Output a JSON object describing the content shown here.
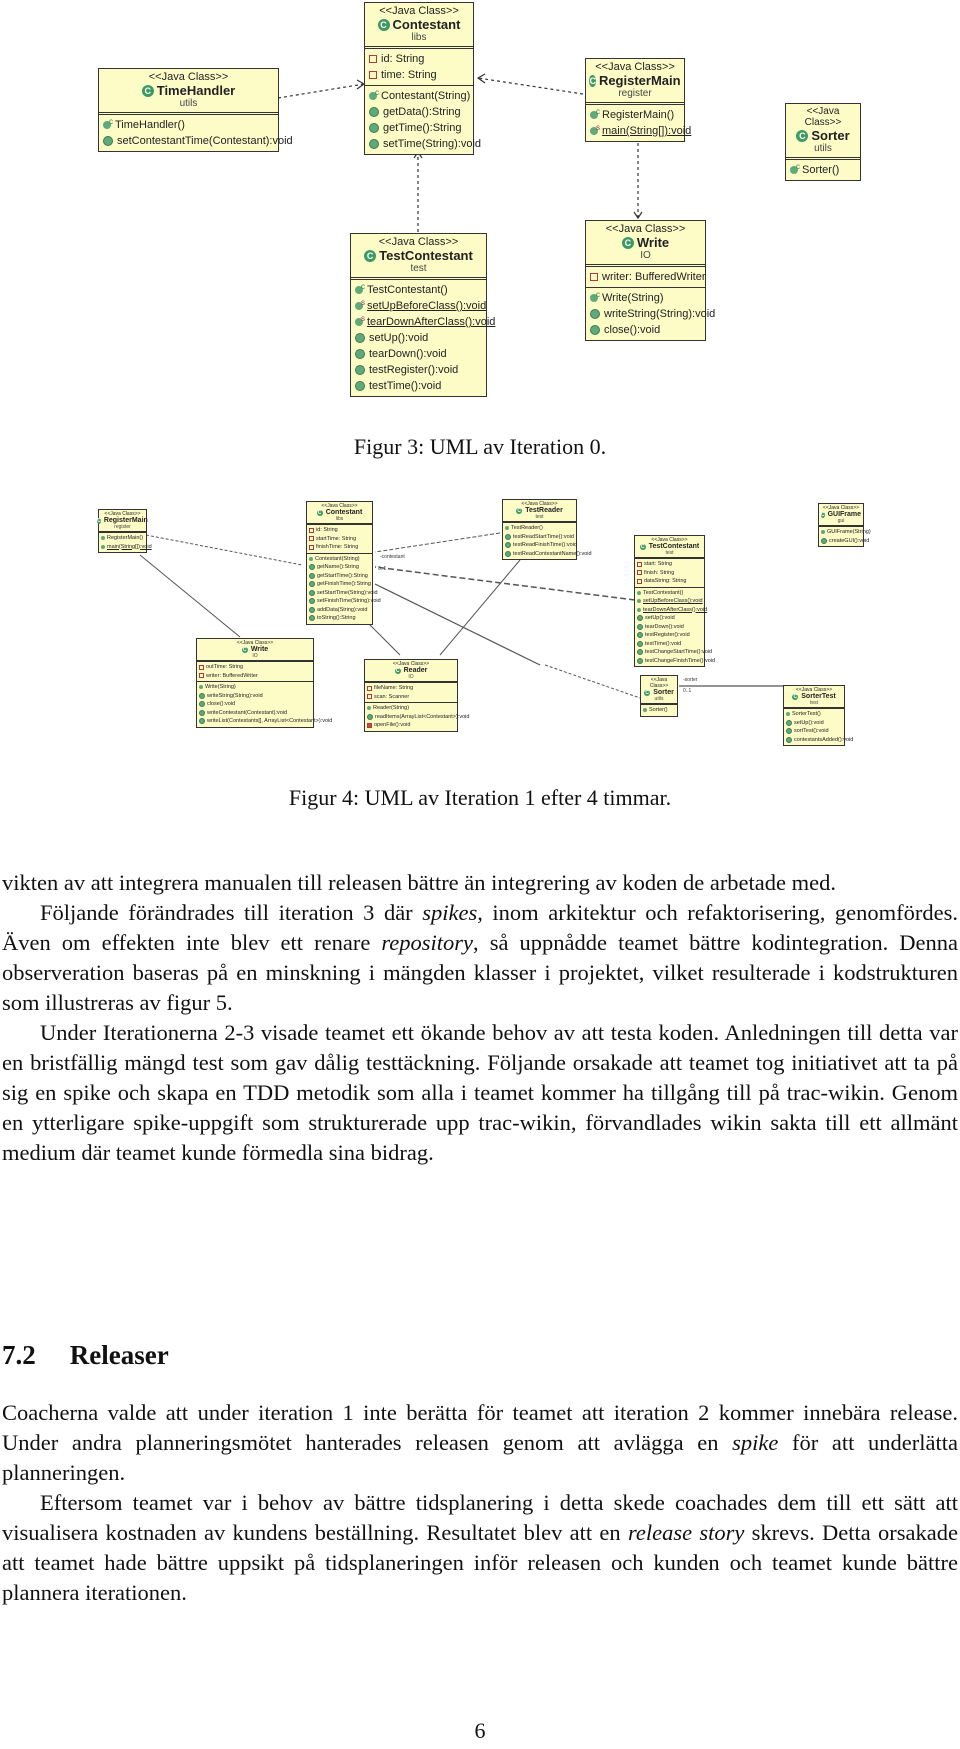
{
  "figure3": {
    "caption": "Figur 3: UML av Iteration 0.",
    "stereotype": "<<Java Class>>",
    "classes": {
      "timehandler": {
        "name": "TimeHandler",
        "package": "utils",
        "attributes": [],
        "methods": [
          "TimeHandler()",
          "setContestantTime(Contestant):void"
        ]
      },
      "contestant": {
        "name": "Contestant",
        "package": "libs",
        "attributes": [
          "id: String",
          "time: String"
        ],
        "methods": [
          "Contestant(String)",
          "getData():String",
          "getTime():String",
          "setTime(String):void"
        ]
      },
      "registermain": {
        "name": "RegisterMain",
        "package": "register",
        "attributes": [],
        "methods": [
          "RegisterMain()",
          "main(String[]):void"
        ]
      },
      "sorter": {
        "name": "Sorter",
        "package": "utils",
        "attributes": [],
        "methods": [
          "Sorter()"
        ]
      },
      "testcontestant": {
        "name": "TestContestant",
        "package": "test",
        "attributes": [],
        "methods": [
          "TestContestant()",
          "setUpBeforeClass():void",
          "tearDownAfterClass():void",
          "setUp():void",
          "tearDown():void",
          "testRegister():void",
          "testTime():void"
        ]
      },
      "write": {
        "name": "Write",
        "package": "IO",
        "attributes": [
          "writer: BufferedWriter"
        ],
        "methods": [
          "Write(String)",
          "writeString(String):void",
          "close():void"
        ]
      }
    }
  },
  "figure4": {
    "caption": "Figur 4: UML av Iteration 1 efter 4 timmar.",
    "stereotype": "<<Java Class>>",
    "classes": {
      "registermain": {
        "name": "RegisterMain",
        "package": "register",
        "attributes": [],
        "methods": [
          "RegisterMain()",
          "main(String[]):void"
        ]
      },
      "contestant": {
        "name": "Contestant",
        "package": "libs",
        "attributes": [
          "id: String",
          "startTime: String",
          "finishTime: String"
        ],
        "methods": [
          "Contestant(String)",
          "getName():String",
          "getStartTime():String",
          "getFinishTime():String",
          "setStartTime(String):void",
          "setFinishTime(String):void",
          "addData(String):void",
          "toString():String"
        ]
      },
      "testreader": {
        "name": "TestReader",
        "package": "test",
        "attributes": [],
        "methods": [
          "TestReader()",
          "testReadStartTime():void",
          "testReadFinishTime():void",
          "testReadContestantName():void"
        ]
      },
      "testcontestant": {
        "name": "TestContestant",
        "package": "test",
        "attributes": [
          "start: String",
          "finish: String",
          "dataString: String"
        ],
        "methods": [
          "TestContestant()",
          "setUpBeforeClass():void",
          "tearDownAfterClass():void",
          "setUp():void",
          "tearDown():void",
          "testRegister():void",
          "testTime():void",
          "testChangeStartTime():void",
          "testChangeFinishTime():void"
        ]
      },
      "guiframe": {
        "name": "GUIFrame",
        "package": "gui",
        "attributes": [],
        "methods": [
          "GUIFrame(String)",
          "createGUI():void"
        ]
      },
      "write": {
        "name": "Write",
        "package": "IO",
        "attributes": [
          "outTime: String",
          "writer: BufferedWriter"
        ],
        "methods": [
          "Write(String)",
          "writeString(String):void",
          "close():void",
          "writeContestant(Contestant):void",
          "writeList(Contestants[], ArrayList<Contestant>):void"
        ]
      },
      "reader": {
        "name": "Reader",
        "package": "IO",
        "attributes": [
          "fileName: String",
          "scan: Scanner"
        ],
        "methods": [
          "Reader(String)",
          "readItems(ArrayList<Contestant>):void",
          "openFile():void"
        ]
      },
      "sorter": {
        "name": "Sorter",
        "package": "utils",
        "attributes": [],
        "methods": [
          "Sorter()"
        ]
      },
      "sortertest": {
        "name": "SorterTest",
        "package": "test",
        "attributes": [],
        "methods": [
          "SorterTest()",
          "setUp():void",
          "sortTest():void",
          "contestantsAdded():void"
        ]
      }
    },
    "link_labels": [
      "-contestant",
      "0..1",
      "-sorter",
      "0..1"
    ]
  },
  "body": {
    "p1": "vikten av att integrera manualen till releasen bättre än integrering av koden de arbetade med.",
    "p2_a": "Följande förändrades till iteration 3 där ",
    "p2_em1": "spikes",
    "p2_b": ", inom arkitektur och refaktorisering, genomfördes. Även om effekten inte blev ett renare ",
    "p2_em2": "repository",
    "p2_c": ", så uppnådde teamet bättre kodintegration. Denna observeration baseras på en minskning i mängden klasser i projektet, vilket resulterade i kodstrukturen som illustreras av figur 5.",
    "p3": "Under Iterationerna 2-3 visade teamet ett ökande behov av att testa koden. Anledningen till detta var en bristfällig mängd test som gav dålig testtäckning. Följande orsakade att teamet tog initiativet att ta på sig en spike och skapa en TDD metodik som alla i teamet kommer ha tillgång till på trac-wikin. Genom en ytterligare spike-uppgift som strukturerade upp trac-wikin, förvandlades wikin sakta till ett allmänt medium där teamet kunde förmedla sina bidrag."
  },
  "section": {
    "number": "7.2",
    "title": "Releaser",
    "p1_a": "Coacherna valde att under iteration 1 inte berätta för teamet att iteration 2 kommer innebära release. Under andra planneringsmötet hanterades releasen genom att avlägga en ",
    "p1_em": "spike",
    "p1_b": " för att underlätta planneringen.",
    "p2_a": "Eftersom teamet var i behov av bättre tidsplanering i detta skede coachades dem till ett sätt att visualisera kostnaden av kundens beställning. Resultatet blev att en ",
    "p2_em": "release story",
    "p2_b": " skrevs. Detta orsakade att teamet hade bättre uppsikt på tidsplaneringen inför releasen och kunden och teamet kunde bättre plannera iterationen."
  },
  "page_number": "6"
}
